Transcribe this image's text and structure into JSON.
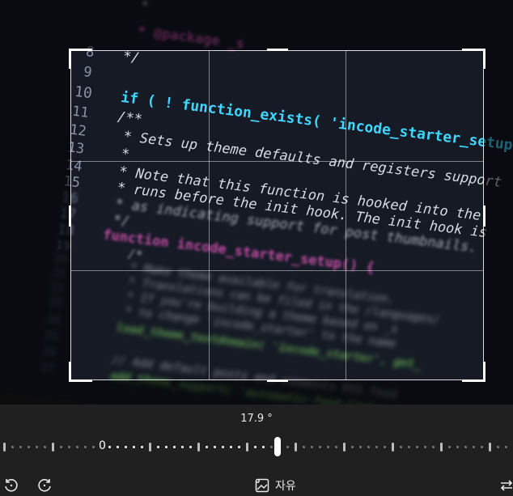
{
  "photo": {
    "code_lines": [
      {
        "num": "",
        "text": "*"
      },
      {
        "num": "",
        "text": "* @package _s"
      },
      {
        "num": "8",
        "text": "*/"
      },
      {
        "num": "9",
        "text": ""
      },
      {
        "num": "10",
        "text": "if ( ! function_exists( 'incode_starter_setup' ) ) :"
      },
      {
        "num": "11",
        "text": "/**"
      },
      {
        "num": "12",
        "text": " * Sets up theme defaults and registers support"
      },
      {
        "num": "13",
        "text": " *"
      },
      {
        "num": "14",
        "text": " * Note that this function is hooked into the"
      },
      {
        "num": "15",
        "text": " * runs before the init hook. The init hook is"
      },
      {
        "num": "16",
        "text": " * as indicating support for post thumbnails."
      },
      {
        "num": "17",
        "text": " */"
      },
      {
        "num": "18",
        "text": "function incode_starter_setup() {"
      },
      {
        "num": "19",
        "text": "    /*"
      },
      {
        "num": "20",
        "text": "     * Make theme available for translation."
      },
      {
        "num": "21",
        "text": "     * Translations can be filed in the /languages/"
      },
      {
        "num": "22",
        "text": "     * If you're building a theme based on _s"
      },
      {
        "num": "23",
        "text": "     * to change 'incode_starter' to the name"
      },
      {
        "num": "24",
        "text": "    load_theme_textdomain( 'incode_starter', get_"
      },
      {
        "num": "25",
        "text": ""
      },
      {
        "num": "26",
        "text": "    // Add default posts and comments RSS feed"
      },
      {
        "num": "27",
        "text": "    add_theme_support( 'automatic-feed-links' );"
      }
    ]
  },
  "rotation": {
    "angle_label": "17.9 °",
    "zero_label": "0"
  },
  "toolbar": {
    "aspect_label": "자유"
  },
  "colors": {
    "background": "#202020",
    "keyword": "#ff5fd0",
    "function": "#3fd6ff",
    "string": "#f0e06a"
  },
  "icons": [
    "rotate-left-icon",
    "rotate-right-icon",
    "aspect-ratio-icon",
    "flip-icon"
  ]
}
